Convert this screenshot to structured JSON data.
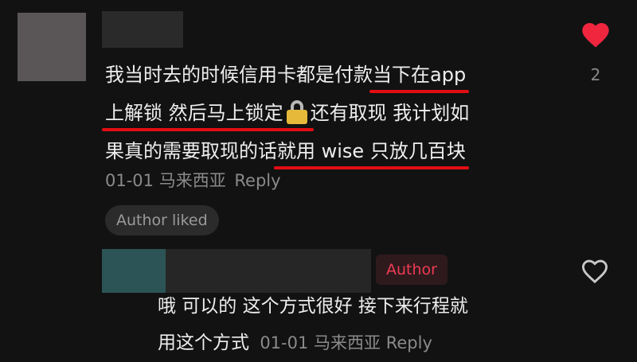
{
  "comment": {
    "line1_plain": "我当时去的时候信用卡都是付款",
    "line1_underlined": "当下在app",
    "line2_underlined": "上解锁 然后马上锁定",
    "line2_plain": "还有取现 我计划如",
    "line3_plain": "果真的需要取现的话",
    "line3_underlined": "就用 wise 只放几百块",
    "date": "01-01",
    "location": "马来西亚",
    "reply_label": "Reply",
    "author_liked": "Author liked",
    "like_count": "2"
  },
  "reply": {
    "badge": "Author",
    "line1": "哦 可以的 这个方式很好 接下来行程就",
    "line2": "用这个方式",
    "date": "01-01",
    "location": "马来西亚",
    "reply_label": "Reply"
  },
  "colors": {
    "background": "#121212",
    "heart": "#f0263f",
    "underline": "#e30d14",
    "author_badge_text": "#ec3b52"
  },
  "icons": [
    "heart-filled-icon",
    "heart-outline-icon",
    "lock-icon"
  ]
}
